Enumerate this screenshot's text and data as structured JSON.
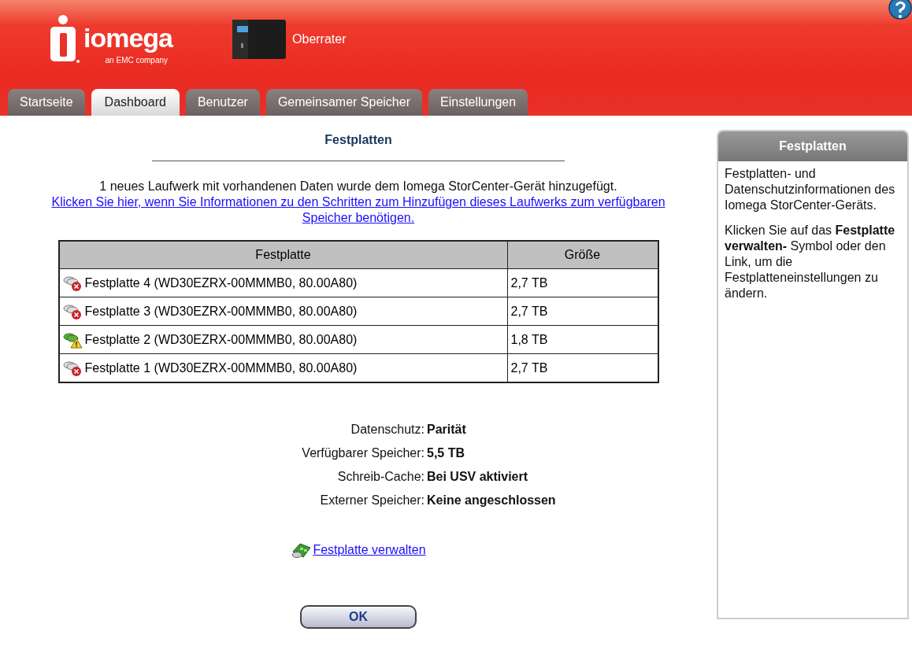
{
  "header": {
    "brand": "iomega",
    "brand_tagline": "an EMC company",
    "device_name": "Oberrater"
  },
  "tabs": [
    {
      "label": "Startseite",
      "selected": false
    },
    {
      "label": "Dashboard",
      "selected": true
    },
    {
      "label": "Benutzer",
      "selected": false
    },
    {
      "label": "Gemeinsamer Speicher",
      "selected": false
    },
    {
      "label": "Einstellungen",
      "selected": false
    }
  ],
  "main": {
    "title": "Festplatten",
    "notice": "1 neues Laufwerk mit vorhandenen Daten wurde dem Iomega StorCenter-Gerät hinzugefügt.",
    "notice_link": "Klicken Sie hier, wenn Sie Informationen zu den Schritten zum Hinzufügen dieses Laufwerks zum verfügbaren Speicher benötigen.",
    "table": {
      "columns": [
        "Festplatte",
        "Größe"
      ],
      "rows": [
        {
          "kind": "error",
          "name": "Festplatte 4 (WD30EZRX-00MMMB0, 80.00A80)",
          "size": "2,7 TB"
        },
        {
          "kind": "error",
          "name": "Festplatte 3 (WD30EZRX-00MMMB0, 80.00A80)",
          "size": "2,7 TB"
        },
        {
          "kind": "warning",
          "name": "Festplatte 2 (WD30EZRX-00MMMB0, 80.00A80)",
          "size": "1,8 TB"
        },
        {
          "kind": "error",
          "name": "Festplatte 1 (WD30EZRX-00MMMB0, 80.00A80)",
          "size": "2,7 TB"
        }
      ]
    },
    "details": [
      {
        "label": "Datenschutz:",
        "value": "Parität"
      },
      {
        "label": "Verfügbarer Speicher:",
        "value": "5,5 TB"
      },
      {
        "label": "Schreib-Cache:",
        "value": "Bei USV aktiviert"
      },
      {
        "label": "Externer Speicher:",
        "value": "Keine angeschlossen"
      }
    ],
    "manage_link": "Festplatte verwalten",
    "ok_button": "OK"
  },
  "sidebar": {
    "title": "Festplatten",
    "paragraphs": [
      "Festplatten- und Datenschutzinformationen des Iomega StorCenter-Geräts.",
      "Klicken Sie auf das **Festplatte verwalten-** Symbol oder den Link, um die Festplatteneinstellungen zu ändern."
    ]
  }
}
